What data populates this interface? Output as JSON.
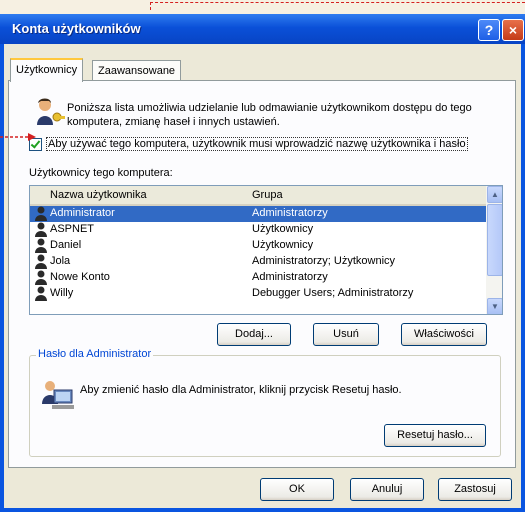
{
  "window": {
    "title": "Konta użytkowników",
    "help_glyph": "?",
    "close_glyph": "×"
  },
  "tabs": [
    {
      "label": "Użytkownicy"
    },
    {
      "label": "Zaawansowane"
    }
  ],
  "intro": "Poniższa lista umożliwia udzielanie lub odmawianie użytkownikom dostępu do tego komputera, zmianę haseł i innych ustawień.",
  "require_login": {
    "checked": true,
    "label": "Aby używać tego komputera, użytkownik musi wprowadzić nazwę użytkownika i hasło"
  },
  "users": {
    "label": "Użytkownicy tego komputera:",
    "columns": [
      "Nazwa użytkownika",
      "Grupa"
    ],
    "rows": [
      {
        "name": "Administrator",
        "group": "Administratorzy",
        "selected": true
      },
      {
        "name": "ASPNET",
        "group": "Użytkownicy"
      },
      {
        "name": "Daniel",
        "group": "Użytkownicy"
      },
      {
        "name": "Jola",
        "group": "Administratorzy; Użytkownicy"
      },
      {
        "name": "Nowe Konto",
        "group": "Administratorzy"
      },
      {
        "name": "Willy",
        "group": "Debugger Users; Administratorzy"
      }
    ]
  },
  "list_buttons": {
    "add": "Dodaj...",
    "remove": "Usuń",
    "properties": "Właściwości"
  },
  "password_group": {
    "legend": "Hasło dla Administrator",
    "text": "Aby zmienić hasło dla Administrator, kliknij przycisk Resetuj hasło.",
    "reset_button": "Resetuj hasło..."
  },
  "footer": {
    "ok": "OK",
    "cancel": "Anuluj",
    "apply": "Zastosuj"
  },
  "colors": {
    "accent": "#316ac5",
    "titlebar": "#0a50d8",
    "annotation": "#d42020"
  }
}
